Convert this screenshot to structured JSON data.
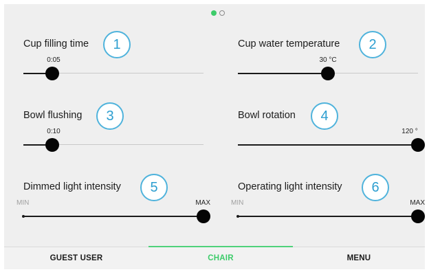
{
  "pager": {
    "pages": 2,
    "active": 0
  },
  "settings": [
    {
      "label": "Cup filling time",
      "badge": "1",
      "value": "0:05",
      "level": 0.16
    },
    {
      "label": "Cup water temperature",
      "badge": "2",
      "value": "30 °C",
      "level": 0.5
    },
    {
      "label": "Bowl flushing",
      "badge": "3",
      "value": "0:10",
      "level": 0.16
    },
    {
      "label": "Bowl rotation",
      "badge": "4",
      "value": "120 °",
      "level": 1.0
    },
    {
      "label": "Dimmed light intensity",
      "badge": "5",
      "min": "MIN",
      "max": "MAX",
      "level": 1.0
    },
    {
      "label": "Operating light intensity",
      "badge": "6",
      "min": "MIN",
      "max": "MAX",
      "level": 1.0
    }
  ],
  "tabs": [
    {
      "label": "GUEST USER",
      "active": false
    },
    {
      "label": "CHAIR",
      "active": true
    },
    {
      "label": "MENU",
      "active": false
    }
  ],
  "colors": {
    "accent": "#3dcc6a",
    "badge_border": "#4fb3dc",
    "badge_text": "#2c9ed0",
    "thumb": "#050505"
  }
}
